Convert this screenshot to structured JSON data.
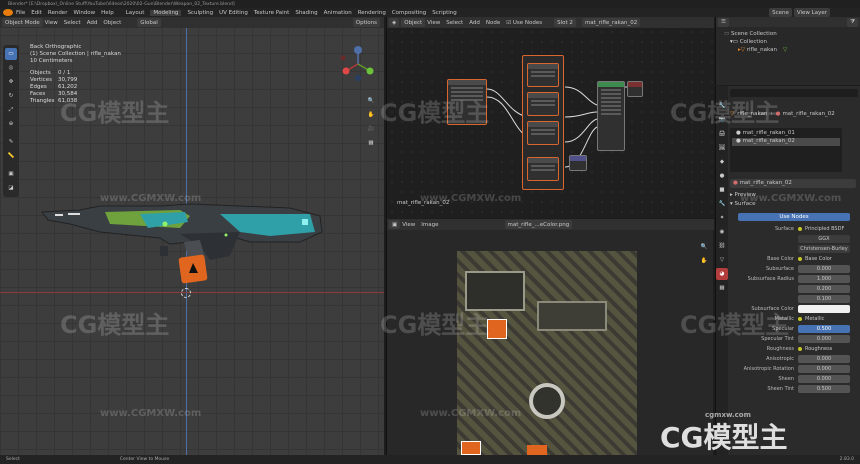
{
  "title": "Blender* [E:\\Dropbox\\_Online Stuff\\YouTube\\Videos\\2020\\02-Gun\\Blender\\Weapon_02_Texture.blend]",
  "menu": [
    "File",
    "Edit",
    "Render",
    "Window",
    "Help"
  ],
  "workspaces": [
    "Layout",
    "Modeling",
    "Sculpting",
    "UV Editing",
    "Texture Paint",
    "Shading",
    "Animation",
    "Rendering",
    "Compositing",
    "Scripting"
  ],
  "scene": "Scene",
  "view_layer": "View Layer",
  "viewport": {
    "mode": "Object Mode",
    "menu": [
      "View",
      "Select",
      "Add",
      "Object"
    ],
    "orientation": "Global",
    "options": "Options",
    "info": [
      "Back Orthographic",
      "(1) Scene Collection | rifle_nakan",
      "10 Centimeters"
    ],
    "stats": [
      {
        "label": "Objects",
        "value": "0 / 1"
      },
      {
        "label": "Vertices",
        "value": "30,799"
      },
      {
        "label": "Edges",
        "value": "61,202"
      },
      {
        "label": "Faces",
        "value": "30,584"
      },
      {
        "label": "Triangles",
        "value": "61,038"
      }
    ]
  },
  "node_editor": {
    "editor": "Object",
    "menu": [
      "View",
      "Select",
      "Add",
      "Node"
    ],
    "use_nodes": "Use Nodes",
    "slot": "Slot 2",
    "material": "mat_rifle_rakan_02",
    "label": "mat_rifle_rakan_02"
  },
  "image_editor": {
    "menu": [
      "View",
      "Image"
    ],
    "image": "mat_rifle_...eColor.png"
  },
  "outliner": {
    "items": [
      "Scene Collection",
      "Collection",
      "rifle_nakan"
    ]
  },
  "properties": {
    "object": "rifle_nakan",
    "material_name": "mat_rifle_rakan_02",
    "slots": [
      "mat_rifle_rakan_01",
      "mat_rifle_rakan_02"
    ],
    "preview": "Preview",
    "surface": "Surface",
    "use_nodes": "Use Nodes",
    "rows": [
      {
        "label": "Surface",
        "value": "Principled BSDF",
        "kind": "link"
      },
      {
        "label": "",
        "value": "GGX",
        "kind": "enum"
      },
      {
        "label": "",
        "value": "Christensen-Burley",
        "kind": "enum"
      },
      {
        "label": "Base Color",
        "value": "Base Color",
        "kind": "link"
      },
      {
        "label": "Subsurface",
        "value": "0.000",
        "kind": "num"
      },
      {
        "label": "Subsurface Radius",
        "value": "1.000",
        "kind": "num"
      },
      {
        "label": "",
        "value": "0.200",
        "kind": "num"
      },
      {
        "label": "",
        "value": "0.100",
        "kind": "num"
      },
      {
        "label": "Subsurface Color",
        "value": "",
        "kind": "color"
      },
      {
        "label": "Metallic",
        "value": "Metallic",
        "kind": "link"
      },
      {
        "label": "Specular",
        "value": "0.500",
        "kind": "num_sel"
      },
      {
        "label": "Specular Tint",
        "value": "0.000",
        "kind": "num"
      },
      {
        "label": "Roughness",
        "value": "Roughness",
        "kind": "link"
      },
      {
        "label": "Anisotropic",
        "value": "0.000",
        "kind": "num"
      },
      {
        "label": "Anisotropic Rotation",
        "value": "0.000",
        "kind": "num"
      },
      {
        "label": "Sheen",
        "value": "0.000",
        "kind": "num"
      },
      {
        "label": "Sheen Tint",
        "value": "0.500",
        "kind": "num"
      }
    ]
  },
  "status": {
    "left": "Select",
    "center": "Center View to Mouse",
    "version": "2.83.0"
  },
  "watermarks": {
    "logo": "CG模型主",
    "url": "www.CGMXW.com",
    "small_url": "cgmxw.com"
  },
  "colors": {
    "accent": "#4772b3",
    "node_outline": "#d9662e",
    "header": "#2b2b2b",
    "viewport_bg": "#3d3d3d"
  }
}
